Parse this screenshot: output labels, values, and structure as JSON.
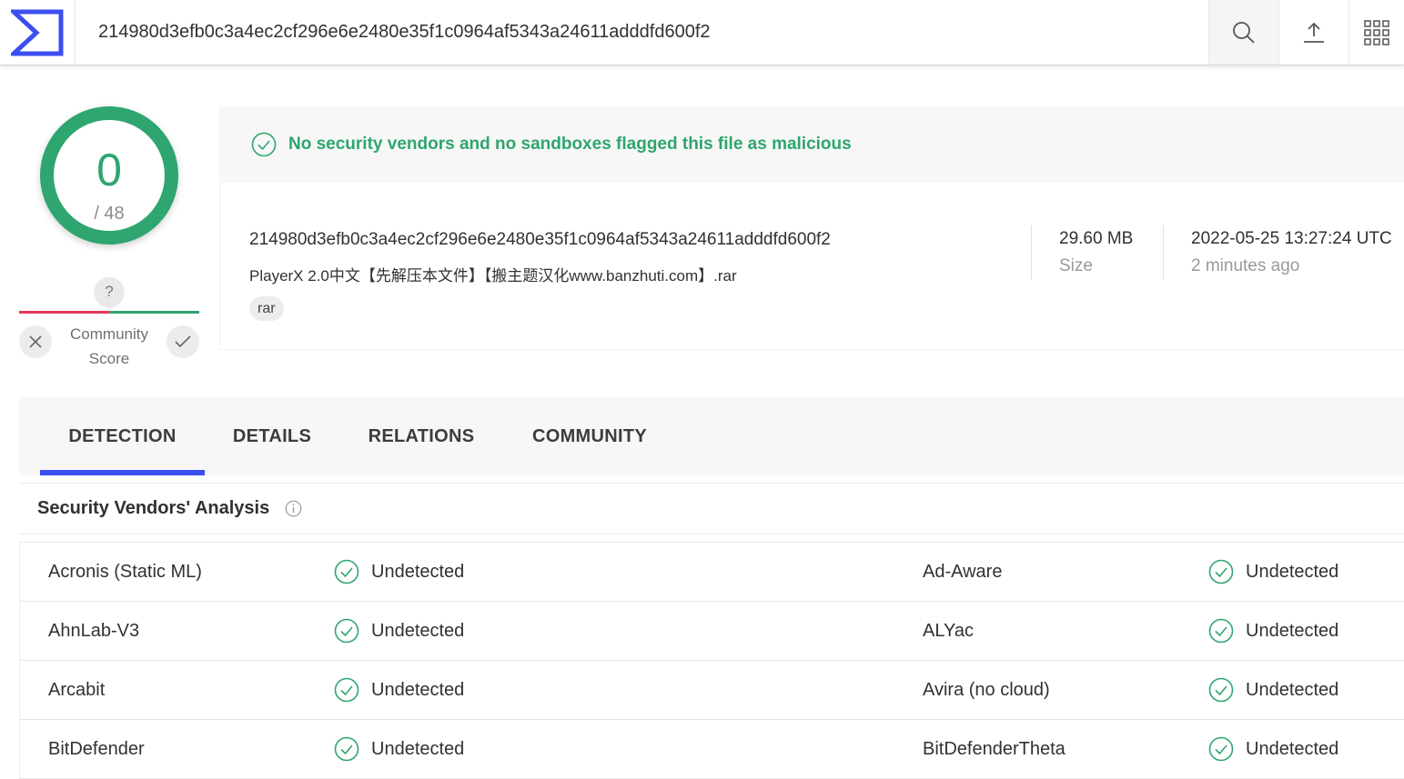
{
  "search": {
    "value": "214980d3efb0c3a4ec2cf296e6e2480e35f1c0964af5343a24611adddfd600f2"
  },
  "score": {
    "detections": "0",
    "total": "/ 48"
  },
  "community": {
    "unknown_symbol": "?",
    "label_line1": "Community",
    "label_line2": "Score"
  },
  "verdict": {
    "message": "No security vendors and no sandboxes flagged this file as malicious"
  },
  "file": {
    "hash": "214980d3efb0c3a4ec2cf296e6e2480e35f1c0964af5343a24611adddfd600f2",
    "name": "PlayerX 2.0中文【先解压本文件】【搬主题汉化www.banzhuti.com】.rar",
    "tag": "rar",
    "size_value": "29.60 MB",
    "size_label": "Size",
    "date_value": "2022-05-25 13:27:24 UTC",
    "date_label": "2 minutes ago"
  },
  "tabs": {
    "detection": "DETECTION",
    "details": "DETAILS",
    "relations": "RELATIONS",
    "community": "COMMUNITY"
  },
  "analysis": {
    "title": "Security Vendors' Analysis"
  },
  "vendors": [
    {
      "left_name": "Acronis (Static ML)",
      "left_result": "Undetected",
      "right_name": "Ad-Aware",
      "right_result": "Undetected"
    },
    {
      "left_name": "AhnLab-V3",
      "left_result": "Undetected",
      "right_name": "ALYac",
      "right_result": "Undetected"
    },
    {
      "left_name": "Arcabit",
      "left_result": "Undetected",
      "right_name": "Avira (no cloud)",
      "right_result": "Undetected"
    },
    {
      "left_name": "BitDefender",
      "left_result": "Undetected",
      "right_name": "BitDefenderTheta",
      "right_result": "Undetected"
    }
  ],
  "colors": {
    "accent": "#3b4ef0",
    "clean": "#2fa56f",
    "malicious": "#e6375b"
  },
  "icons": [
    "virustotal-logo",
    "search-icon",
    "upload-icon",
    "apps-grid-icon",
    "check-circle-icon",
    "close-icon",
    "check-icon",
    "info-icon"
  ]
}
